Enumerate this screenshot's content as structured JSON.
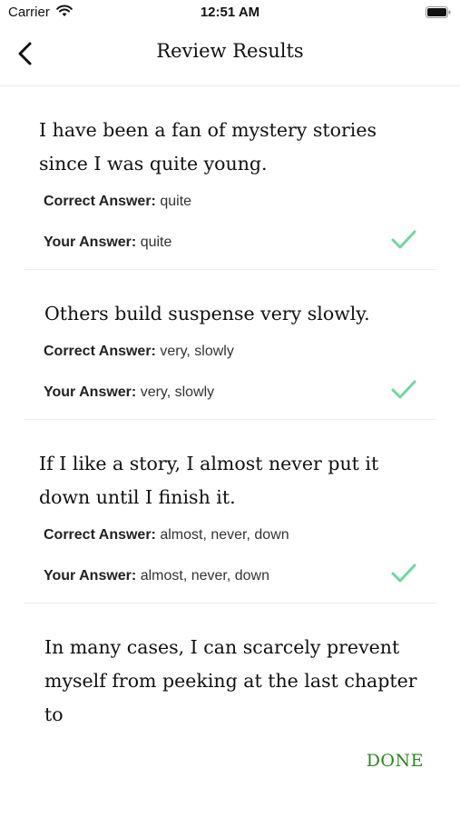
{
  "status_bar": {
    "carrier": "Carrier",
    "time": "12:51 AM"
  },
  "nav": {
    "title": "Review Results",
    "back_icon": "chevron-left-icon"
  },
  "labels": {
    "correct_answer": "Correct Answer:",
    "your_answer": "Your Answer:"
  },
  "items": [
    {
      "question": "I have been a fan of mystery stories since I was quite young.",
      "correct": "quite",
      "yours": "quite",
      "is_correct": true
    },
    {
      "question": "Others build suspense very slowly.",
      "correct": "very, slowly",
      "yours": "very, slowly",
      "is_correct": true
    },
    {
      "question": "If I like a story, I almost never put it down until I finish it.",
      "correct": "almost, never, down",
      "yours": "almost, never, down",
      "is_correct": true
    },
    {
      "question": "In many cases, I can scarcely prevent myself from peeking at the last chapter to"
    }
  ],
  "footer": {
    "done_label": "DONE"
  },
  "colors": {
    "check": "#6fd6a2",
    "done": "#2a8a1e"
  }
}
